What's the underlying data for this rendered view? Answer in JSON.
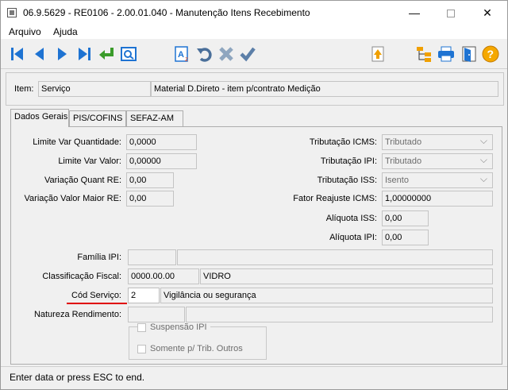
{
  "window": {
    "title": "06.9.5629 - RE0106 - 2.00.01.040 - Manutenção Itens Recebimento",
    "minimize": "—",
    "close": "✕"
  },
  "menu": {
    "arquivo": "Arquivo",
    "ajuda": "Ajuda"
  },
  "toolbar": {
    "icons": [
      "first-record-icon",
      "previous-record-icon",
      "next-record-icon",
      "last-record-icon",
      "return-icon",
      "zoom-icon",
      "font-icon",
      "undo-icon",
      "cancel-icon",
      "confirm-icon",
      "up-icon",
      "tree-icon",
      "print-icon",
      "exit-icon",
      "help-icon"
    ],
    "help_glyph": "?"
  },
  "header": {
    "item_label": "Item:",
    "item_value": "Serviço",
    "item_desc": "Material D.Direto - item p/contrato Medição"
  },
  "tabs": [
    "Dados Gerais",
    "PIS/COFINS",
    "SEFAZ-AM"
  ],
  "form": {
    "limite_var_qtd_label": "Limite Var Quantidade:",
    "limite_var_qtd": "0,0000",
    "limite_var_valor_label": "Limite Var Valor:",
    "limite_var_valor": "0,00000",
    "variacao_quant_re_label": "Variação Quant RE:",
    "variacao_quant_re": "0,00",
    "variacao_valor_maior_re_label": "Variação Valor Maior RE:",
    "variacao_valor_maior_re": "0,00",
    "trib_icms_label": "Tributação ICMS:",
    "trib_icms": "Tributado",
    "trib_ipi_label": "Tributação IPI:",
    "trib_ipi": "Tributado",
    "trib_iss_label": "Tributação ISS:",
    "trib_iss": "Isento",
    "fator_reajuste_icms_label": "Fator Reajuste ICMS:",
    "fator_reajuste_icms": "1,00000000",
    "aliquota_iss_label": "Alíquota ISS:",
    "aliquota_iss": "0,00",
    "aliquota_ipi_label": "Alíquota IPI:",
    "aliquota_ipi": "0,00",
    "familia_ipi_label": "Família IPI:",
    "familia_ipi_code": "",
    "familia_ipi_desc": "",
    "class_fiscal_label": "Classificação Fiscal:",
    "class_fiscal_code": "0000.00.00",
    "class_fiscal_desc": "VIDRO",
    "cod_servico_label": "Cód Serviço:",
    "cod_servico_code": "2",
    "cod_servico_desc": "Vigilância ou segurança",
    "natureza_rend_label": "Natureza Rendimento:",
    "natureza_rend_code": "",
    "natureza_rend_desc": "",
    "suspensao_ipi_label": "Suspensão IPI",
    "somente_trib_outros_label": "Somente p/ Trib. Outros"
  },
  "status": {
    "text": "Enter data or press ESC to end."
  },
  "colors": {
    "toolbar_blue": "#1e73d2",
    "green": "#3a9b2a",
    "red_underline": "#e00000"
  }
}
